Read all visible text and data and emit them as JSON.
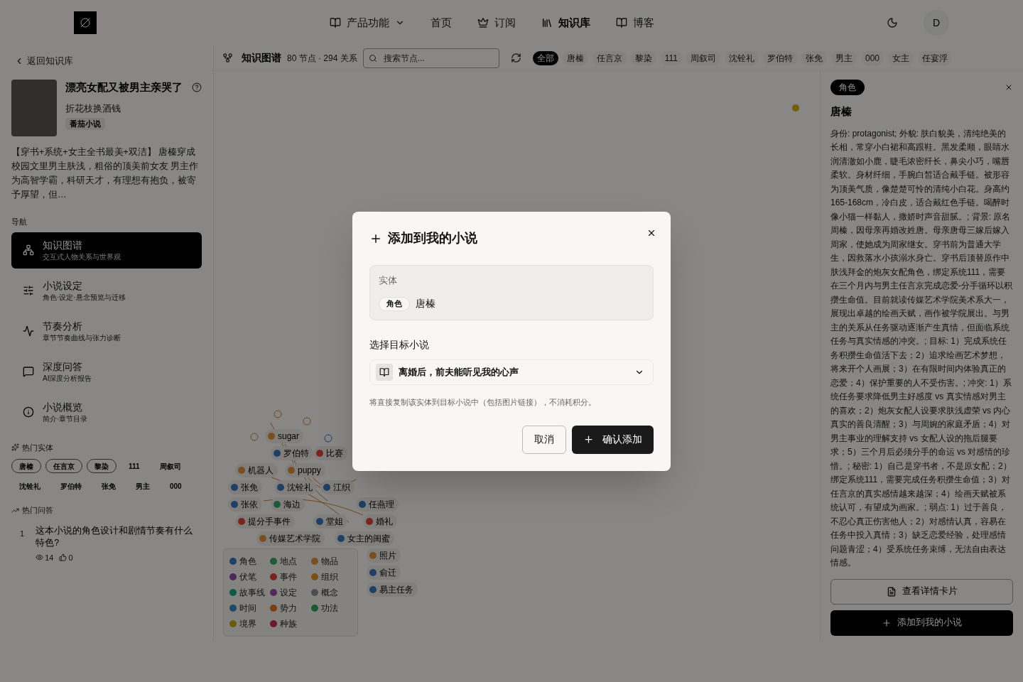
{
  "header": {
    "nav": [
      {
        "label": "产品功能",
        "dropdown": true,
        "selected": false
      },
      {
        "label": "首页",
        "dropdown": false,
        "selected": false
      },
      {
        "label": "订阅",
        "dropdown": false,
        "selected": false
      },
      {
        "label": "知识库",
        "dropdown": false,
        "selected": true
      },
      {
        "label": "博客",
        "dropdown": false,
        "selected": false
      }
    ],
    "avatar": "D"
  },
  "sidebar": {
    "back": "返回知识库",
    "book": {
      "title": "漂亮女配又被男主亲哭了",
      "author": "折花枝换酒钱",
      "tag": "番茄小说",
      "summary": "【穿书+系统+女主全书最美+双洁】 唐榛穿成校园文里男主肤浅，粗俗的顶美前女友 男主作为高智学霸，科研天才，有理想有抱负，被寄予厚望，但…"
    },
    "nav_heading": "导航",
    "items": [
      {
        "title": "知识图谱",
        "subtitle": "交互式人物关系与世界观",
        "selected": true
      },
      {
        "title": "小说设定",
        "subtitle": "角色·设定·悬念预览与迁移",
        "selected": false
      },
      {
        "title": "节奏分析",
        "subtitle": "章节节奏曲线与张力诊断",
        "selected": false
      },
      {
        "title": "深度问答",
        "subtitle": "AI深度分析报告",
        "selected": false
      },
      {
        "title": "小说概览",
        "subtitle": "简介·章节目录",
        "selected": false
      }
    ],
    "hot_entities_heading": "热门实体",
    "hot_entities": [
      {
        "label": "唐榛",
        "highlighted": true
      },
      {
        "label": "任言京",
        "highlighted": true
      },
      {
        "label": "黎染",
        "highlighted": true
      },
      {
        "label": "111",
        "highlighted": false
      },
      {
        "label": "周叙司",
        "highlighted": false
      },
      {
        "label": "沈铨礼",
        "highlighted": false
      },
      {
        "label": "罗伯特",
        "highlighted": false
      },
      {
        "label": "张免",
        "highlighted": false
      },
      {
        "label": "男主",
        "highlighted": false
      },
      {
        "label": "000",
        "highlighted": false
      }
    ],
    "hot_qa_heading": "热门问答",
    "hot_qa": [
      {
        "rank": "1",
        "question": "这本小说的角色设计和剧情节奏有什么特色?",
        "views": "14",
        "likes": "0"
      }
    ]
  },
  "graph": {
    "title": "知识图谱",
    "stats": "80 节点 · 294 关系",
    "search": {
      "placeholder": "搜索节点..."
    },
    "filters": [
      {
        "label": "全部",
        "selected": true
      },
      {
        "label": "唐榛",
        "selected": false
      },
      {
        "label": "任言京",
        "selected": false
      },
      {
        "label": "黎染",
        "selected": false
      },
      {
        "label": "111",
        "selected": false
      },
      {
        "label": "周叙司",
        "selected": false
      },
      {
        "label": "沈铨礼",
        "selected": false
      },
      {
        "label": "罗伯特",
        "selected": false
      },
      {
        "label": "张免",
        "selected": false
      },
      {
        "label": "男主",
        "selected": false
      },
      {
        "label": "000",
        "selected": false
      },
      {
        "label": "女主",
        "selected": false
      },
      {
        "label": "任宴浮",
        "selected": false
      }
    ],
    "nodes": [
      {
        "label": "sugar",
        "color": "#7a4f1f"
      },
      {
        "label": "罗伯特",
        "color": "#1e3f66"
      },
      {
        "label": "比赛",
        "color": "#7a2420"
      },
      {
        "label": "机器人",
        "color": "#7a4f1f"
      },
      {
        "label": "puppy",
        "color": "#7a4f1f"
      },
      {
        "label": "张免",
        "color": "#1e3f66"
      },
      {
        "label": "沈铨礼",
        "color": "#1e3f66"
      },
      {
        "label": "江织",
        "color": "#1e3f66"
      },
      {
        "label": "张依",
        "color": "#1e3f66"
      },
      {
        "label": "海边",
        "color": "#1f5a37"
      },
      {
        "label": "任燕理",
        "color": "#1e3f66"
      },
      {
        "label": "提分手事件",
        "color": "#7a2420"
      },
      {
        "label": "堂姐",
        "color": "#1e3f66"
      },
      {
        "label": "婚礼",
        "color": "#7a2420"
      },
      {
        "label": "传媒艺术学院",
        "color": "#7a4f1f"
      },
      {
        "label": "女主的闺蜜",
        "color": "#1e3f66"
      },
      {
        "label": "照片",
        "color": "#7a4f1f"
      },
      {
        "label": "俞迁",
        "color": "#1e3f66"
      },
      {
        "label": "易主任务",
        "color": "#1e3f66"
      }
    ],
    "legend": [
      {
        "label": "角色",
        "color": "#1e3f66"
      },
      {
        "label": "地点",
        "color": "#1f5a37"
      },
      {
        "label": "物品",
        "color": "#7a4f1f"
      },
      {
        "label": "伏笔",
        "color": "#4a2a5a"
      },
      {
        "label": "事件",
        "color": "#7a2420"
      },
      {
        "label": "组织",
        "color": "#7a5010"
      },
      {
        "label": "故事线",
        "color": "#0f5a48"
      },
      {
        "label": "设定",
        "color": "#52285e"
      },
      {
        "label": "概念",
        "color": "#4c5050"
      },
      {
        "label": "时间",
        "color": "#1e4a6a"
      },
      {
        "label": "势力",
        "color": "#7a3f10"
      },
      {
        "label": "功法",
        "color": "#1a5a30"
      },
      {
        "label": "境界",
        "color": "#6a5a10"
      },
      {
        "label": "种族",
        "color": "#6a1a38"
      }
    ]
  },
  "detail": {
    "type": "角色",
    "name": "唐榛",
    "description": "身份: protagonist; 外貌: 肤白貌美，清纯绝美的长相，常穿小白裙和高跟鞋。黑发柔顺，眼睛水润清澈如小鹿，睫毛浓密纤长，鼻尖小巧，嘴唇柔软。身材纤细，手腕白皙适合戴手链。被形容为顶美气质，像楚楚可怜的清纯小白花。身高约165-168cm，冷白皮，适合戴红色手链。喝醉时像小猫一样黏人，撒娇时声音甜腻。; 背景: 原名周榛，因母亲再婚改姓唐。母亲唐母三嫁后嫁入周家，使她成为周家继女。穿书前为普通大学生，因救落水小孩溺水身亡。穿书后顶替原作中肤浅拜金的炮灰女配角色，绑定系统111，需要在三个月内与男主任言京完成恋爱-分手循环以积攒生命值。目前就读传媒艺术学院美术系大一，展现出卓越的绘画天赋，画作被学院展出。与男主的关系从任务驱动逐渐产生真情，但面临系统任务与真实情感的冲突。; 目标: 1）完成系统任务积攒生命值活下去；2）追求绘画艺术梦想，将来开个人画展；3）在有限时间内体验真正的恋爱；4）保护重要的人不受伤害。; 冲突: 1）系统任务要求降低男主好感度 vs 真实情感对男主的喜欢；2）炮灰女配人设要求肤浅虚荣 vs 内心真实的善良清醒；3）与周婉的家庭矛盾；4）对男主事业的理解支持 vs 女配人设的拖后腿要求；5）三个月后必须分手的命运 vs 对感情的珍惜。; 秘密: 1）自己是穿书者，不是原女配；2）绑定系统111，需要完成任务积攒生命值；3）对任言京的真实感情越来越深；4）绘画天赋被系统认可，有望成为画家。; 弱点: 1）过于善良，不忍心真正伤害他人；2）对感情认真，容易在任务中投入真情；3）缺乏恋爱经验，处理感情问题青涩；4）受系统任务束缚，无法自由表达情感。",
    "card_button": "查看详情卡片",
    "add_button": "添加到我的小说"
  },
  "modal": {
    "title": "添加到我的小说",
    "entity_label": "实体",
    "entity_type": "角色",
    "entity_name": "唐榛",
    "target_label": "选择目标小说",
    "target_value": "离婚后，前夫能听见我的心声",
    "note": "将直接复制该实体到目标小说中（包括图片链接），不消耗积分。",
    "cancel": "取消",
    "confirm": "确认添加"
  }
}
